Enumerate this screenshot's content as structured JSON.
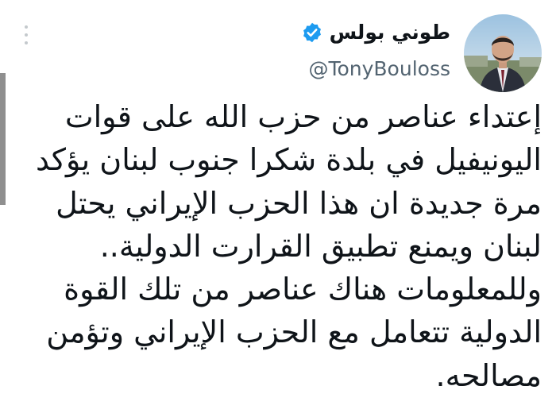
{
  "tweet": {
    "author": {
      "display_name": "طوني بولس",
      "handle": "@TonyBouloss",
      "verified_icon": "verified-badge-icon",
      "verified_color": "#1d9bf0"
    },
    "more_icon": "more-options-icon",
    "text_lines": [
      "إعتداء عناصر من حزب الله على قوات",
      "اليونيفيل في بلدة شكرا جنوب لبنان يؤكد",
      "مرة جديدة ان هذا الحزب الإيراني يحتل",
      "لبنان ويمنع تطبيق القرارت الدولية..",
      "وللمعلومات هناك عناصر من تلك القوة",
      "الدولية تتعامل مع الحزب الإيراني وتؤمن",
      "مصالحه."
    ]
  }
}
